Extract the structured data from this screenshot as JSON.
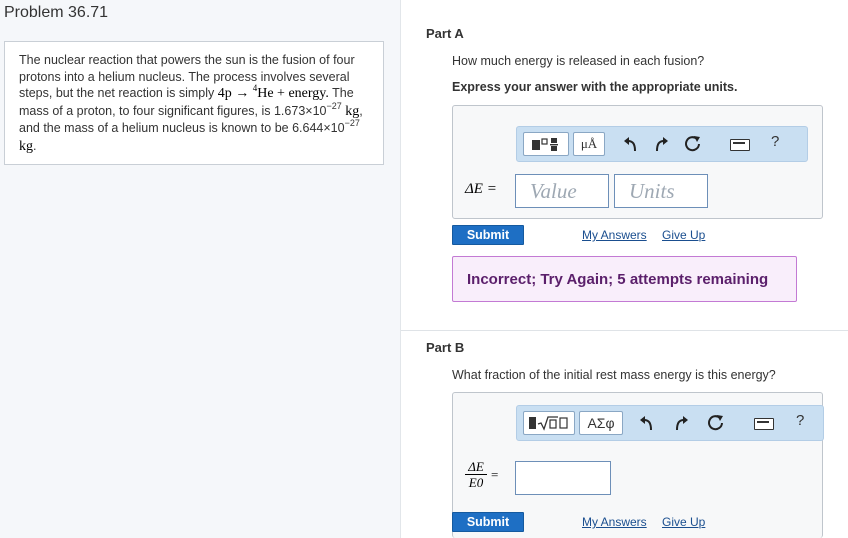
{
  "problem": {
    "title": "Problem 36.71",
    "text_1": "The nuclear reaction that powers the sun is the fusion of four protons into a helium nucleus. The process involves several steps, but the net reaction is simply ",
    "reaction": "4p → ",
    "he_sup": "4",
    "he_rest": "He + energy.",
    "text_2": " The mass of a proton, to four significant figures, is ",
    "proton_mass": "1.673×10",
    "exp_1": "−27",
    "unit_1": " kg",
    "text_3": ", and the mass of a helium nucleus is known to be ",
    "helium_mass": "6.644×10",
    "exp_2": "−27",
    "unit_2": " kg",
    "text_4": "."
  },
  "part_a": {
    "title": "Part A",
    "question": "How much energy is released in each fusion?",
    "instruction": "Express your answer with the appropriate units.",
    "unit_button": "μÅ",
    "help": "?",
    "var_label": "ΔE =",
    "value_placeholder": "Value",
    "units_placeholder": "Units",
    "submit": "Submit",
    "my_answers": "My Answers",
    "give_up": "Give Up",
    "feedback": "Incorrect; Try Again; 5 attempts remaining"
  },
  "part_b": {
    "title": "Part B",
    "question": "What fraction of the initial rest mass energy is this energy?",
    "greek_button": "ΑΣφ",
    "help": "?",
    "frac_num": "ΔE",
    "frac_den": "E0",
    "equals": "=",
    "submit": "Submit",
    "my_answers": "My Answers",
    "give_up": "Give Up"
  },
  "icons": [
    "template-icon",
    "undo-icon",
    "redo-icon",
    "reset-icon",
    "keyboard-icon",
    "sqrt-icon"
  ]
}
